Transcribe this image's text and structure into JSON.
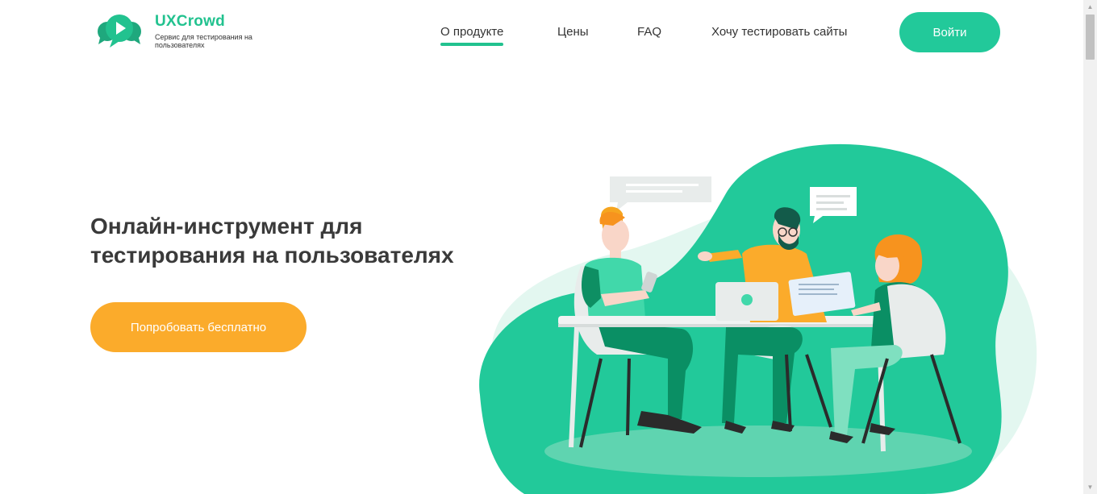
{
  "brand": {
    "name": "UXCrowd",
    "tagline": "Сервис для тестирования на пользователях",
    "color": "#22c28f"
  },
  "nav": {
    "items": [
      {
        "label": "О продукте",
        "active": true
      },
      {
        "label": "Цены",
        "active": false
      },
      {
        "label": "FAQ",
        "active": false
      },
      {
        "label": "Хочу тестировать сайты",
        "active": false
      }
    ],
    "login_label": "Войти"
  },
  "hero": {
    "title": "Онлайн-инструмент для\nтестирования на пользователях",
    "cta_label": "Попробовать бесплатно",
    "cta_color": "#fbab2b"
  },
  "illustration": {
    "icon": "people-at-table-illustration",
    "accent": "#22c99a"
  }
}
